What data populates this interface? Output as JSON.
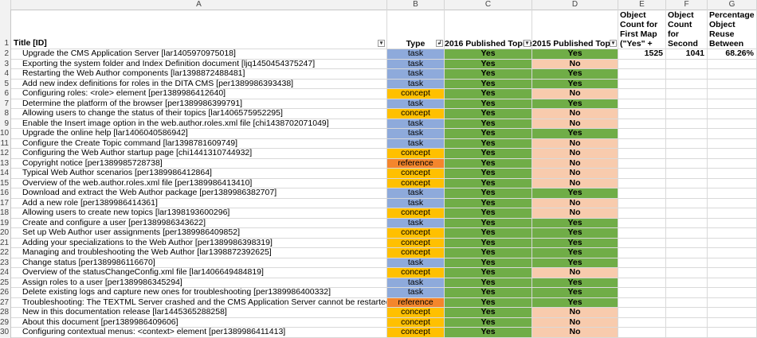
{
  "columns": [
    "A",
    "B",
    "C",
    "D",
    "E",
    "F",
    "G"
  ],
  "header_row": {
    "row_num": "1",
    "title": "Title [ID]",
    "type": "Type",
    "pub2016": "2016 Published Topics",
    "pub2015": "2015 Published Topics",
    "e": "Object Count for First Map (\"Yes\" + \"No\")",
    "f": "Object Count for Second Map (\"Yes\" Only)",
    "g": "Percentage Object Reuse Between Maps"
  },
  "summary": {
    "e": "1525",
    "f": "1041",
    "g": "68.26%"
  },
  "rows": [
    {
      "n": "2",
      "title": "Upgrade the CMS Application Server [lar1405970975018]",
      "type": "task",
      "y16": "Yes",
      "y15": "Yes"
    },
    {
      "n": "3",
      "title": "Exporting the system folder and Index Definition document [ljq1450454375247]",
      "type": "task",
      "y16": "Yes",
      "y15": "No"
    },
    {
      "n": "4",
      "title": "Restarting the Web Author components [lar1398872488481]",
      "type": "task",
      "y16": "Yes",
      "y15": "Yes"
    },
    {
      "n": "5",
      "title": "Add new index definitions for roles in the DITA CMS [per1389986393438]",
      "type": "task",
      "y16": "Yes",
      "y15": "Yes"
    },
    {
      "n": "6",
      "title": "Configuring roles: <role> element [per1389986412640]",
      "type": "concept",
      "y16": "Yes",
      "y15": "No"
    },
    {
      "n": "7",
      "title": "Determine the platform of the browser [per1389986399791]",
      "type": "task",
      "y16": "Yes",
      "y15": "Yes"
    },
    {
      "n": "8",
      "title": "Allowing users to change the status of their topics [lar1406575952295]",
      "type": "concept",
      "y16": "Yes",
      "y15": "No"
    },
    {
      "n": "9",
      "title": "Enable the Insert image option in the web.author.roles.xml file [chi1438702071049]",
      "type": "task",
      "y16": "Yes",
      "y15": "No"
    },
    {
      "n": "10",
      "title": "Upgrade the online help [lar1406040586942]",
      "type": "task",
      "y16": "Yes",
      "y15": "Yes"
    },
    {
      "n": "11",
      "title": "Configure the Create Topic command [lar1398781609749]",
      "type": "task",
      "y16": "Yes",
      "y15": "No"
    },
    {
      "n": "12",
      "title": "Configuring the Web Author startup page [chi1441310744932]",
      "type": "concept",
      "y16": "Yes",
      "y15": "No"
    },
    {
      "n": "13",
      "title": "Copyright notice [per1389985728738]",
      "type": "reference",
      "y16": "Yes",
      "y15": "No"
    },
    {
      "n": "14",
      "title": "Typical Web Author scenarios [per1389986412864]",
      "type": "concept",
      "y16": "Yes",
      "y15": "No"
    },
    {
      "n": "15",
      "title": "Overview of the web.author.roles.xml file [per1389986413410]",
      "type": "concept",
      "y16": "Yes",
      "y15": "No"
    },
    {
      "n": "16",
      "title": "Download and extract the Web Author package [per1389986382707]",
      "type": "task",
      "y16": "Yes",
      "y15": "Yes"
    },
    {
      "n": "17",
      "title": "Add a new role [per1389986414361]",
      "type": "task",
      "y16": "Yes",
      "y15": "No"
    },
    {
      "n": "18",
      "title": "Allowing users to create new topics [lar1398193600296]",
      "type": "concept",
      "y16": "Yes",
      "y15": "No"
    },
    {
      "n": "19",
      "title": "Create and configure a user [per1389986343622]",
      "type": "task",
      "y16": "Yes",
      "y15": "Yes"
    },
    {
      "n": "20",
      "title": "Set up Web Author user assignments [per1389986409852]",
      "type": "concept",
      "y16": "Yes",
      "y15": "Yes"
    },
    {
      "n": "21",
      "title": "Adding your specializations to the Web Author [per1389986398319]",
      "type": "concept",
      "y16": "Yes",
      "y15": "Yes"
    },
    {
      "n": "22",
      "title": "Managing and troubleshooting the Web Author [lar1398872392625]",
      "type": "concept",
      "y16": "Yes",
      "y15": "Yes"
    },
    {
      "n": "23",
      "title": "Change status [per1389986116670]",
      "type": "task",
      "y16": "Yes",
      "y15": "Yes"
    },
    {
      "n": "24",
      "title": "Overview of the statusChangeConfig.xml file [lar1406649484819]",
      "type": "concept",
      "y16": "Yes",
      "y15": "No"
    },
    {
      "n": "25",
      "title": "Assign roles to a user [per1389986345294]",
      "type": "task",
      "y16": "Yes",
      "y15": "Yes"
    },
    {
      "n": "26",
      "title": "Delete existing logs and capture new ones for troubleshooting [per1389986400332]",
      "type": "task",
      "y16": "Yes",
      "y15": "Yes"
    },
    {
      "n": "27",
      "title": "Troubleshooting: The TEXTML Server crashed and the CMS Application Server cannot be restarted [lar1398873347426]",
      "type": "reference",
      "y16": "Yes",
      "y15": "Yes"
    },
    {
      "n": "28",
      "title": "New in this documentation release [lar1445365288258]",
      "type": "concept",
      "y16": "Yes",
      "y15": "No"
    },
    {
      "n": "29",
      "title": "About this document [per1389986409606]",
      "type": "concept",
      "y16": "Yes",
      "y15": "No"
    },
    {
      "n": "30",
      "title": "Configuring contextual menus: <context> element [per1389986411413]",
      "type": "concept",
      "y16": "Yes",
      "y15": "No"
    }
  ],
  "icons": {
    "filter": "filter-dropdown-icon",
    "sort": "sort-filter-icon"
  }
}
